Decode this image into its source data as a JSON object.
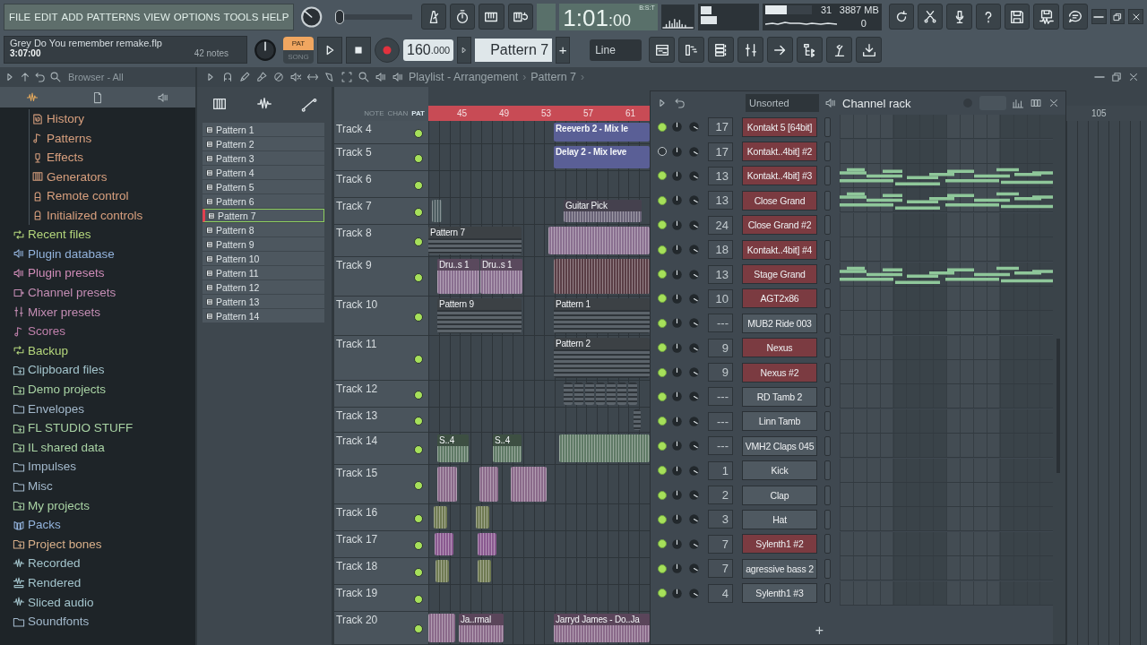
{
  "menu": [
    "FILE",
    "EDIT",
    "ADD",
    "PATTERNS",
    "VIEW",
    "OPTIONS",
    "TOOLS",
    "HELP"
  ],
  "song": {
    "title": "Grey Do You remember remake.flp",
    "length": "3:07:00",
    "notes": "42 notes"
  },
  "transport": {
    "pat": "PAT",
    "song": "SONG",
    "pat_selected": true,
    "tempo": "160",
    "tempo_fraction": ".000",
    "pattern": "Pattern 7",
    "add_pattern": "+"
  },
  "clock": {
    "main": "1:01",
    "sub": ":00",
    "format": "B:S:T"
  },
  "meters": {
    "cpu": "31",
    "level": 0.45,
    "memory": "3887 MB",
    "polyphony": "0"
  },
  "snap": "Line",
  "pitch": {
    "level": 0
  },
  "browser": {
    "title": "Browser - All",
    "project_items": [
      {
        "label": "History",
        "kind": "history",
        "color": "#d9a07e"
      },
      {
        "label": "Patterns",
        "kind": "note",
        "color": "#d9a07e"
      },
      {
        "label": "Effects",
        "kind": "effect",
        "color": "#d9a07e"
      },
      {
        "label": "Generators",
        "kind": "keys",
        "color": "#d9a07e"
      },
      {
        "label": "Remote control",
        "kind": "remote",
        "color": "#d9a07e"
      },
      {
        "label": "Initialized controls",
        "kind": "remote",
        "color": "#d9a07e"
      }
    ],
    "items": [
      {
        "label": "Recent files",
        "kind": "recycle",
        "color": "#b5d77c"
      },
      {
        "label": "Plugin database",
        "kind": "speaker",
        "color": "#93b3dc"
      },
      {
        "label": "Plugin presets",
        "kind": "speaker",
        "color": "#d08cb8"
      },
      {
        "label": "Channel presets",
        "kind": "channel",
        "color": "#c48db4"
      },
      {
        "label": "Mixer presets",
        "kind": "mixer",
        "color": "#c48db4"
      },
      {
        "label": "Scores",
        "kind": "note",
        "color": "#c080ac"
      },
      {
        "label": "Backup",
        "kind": "recycle",
        "color": "#b5d77c"
      },
      {
        "label": "Clipboard files",
        "kind": "folder-plus",
        "color": "#a3c4cc"
      },
      {
        "label": "Demo projects",
        "kind": "folder-plus",
        "color": "#a9d3a4"
      },
      {
        "label": "Envelopes",
        "kind": "folder",
        "color": "#a3b9cc"
      },
      {
        "label": "FL STUDIO STUFF",
        "kind": "folder-plus",
        "color": "#a9d3a4"
      },
      {
        "label": "IL shared data",
        "kind": "folder-plus",
        "color": "#a9d3a4"
      },
      {
        "label": "Impulses",
        "kind": "folder",
        "color": "#a3b9cc"
      },
      {
        "label": "Misc",
        "kind": "folder",
        "color": "#a3b9cc"
      },
      {
        "label": "My projects",
        "kind": "folder-plus",
        "color": "#a9d3a4"
      },
      {
        "label": "Packs",
        "kind": "packs",
        "color": "#93b3dc"
      },
      {
        "label": "Project bones",
        "kind": "folder-plus",
        "color": "#d9b08a"
      },
      {
        "label": "Recorded",
        "kind": "wave",
        "color": "#a3c4cc"
      },
      {
        "label": "Rendered",
        "kind": "rendered",
        "color": "#a3c4cc"
      },
      {
        "label": "Sliced audio",
        "kind": "wave",
        "color": "#a3c4cc"
      },
      {
        "label": "Soundfonts",
        "kind": "folder",
        "color": "#a3b9cc"
      }
    ]
  },
  "patterns": [
    {
      "label": "Pattern 1",
      "selected": false
    },
    {
      "label": "Pattern 2",
      "selected": false
    },
    {
      "label": "Pattern 3",
      "selected": false
    },
    {
      "label": "Pattern 4",
      "selected": false
    },
    {
      "label": "Pattern 5",
      "selected": false
    },
    {
      "label": "Pattern 6",
      "selected": false
    },
    {
      "label": "Pattern 7",
      "selected": true
    },
    {
      "label": "Pattern 8",
      "selected": false
    },
    {
      "label": "Pattern 9",
      "selected": false
    },
    {
      "label": "Pattern 10",
      "selected": false
    },
    {
      "label": "Pattern 11",
      "selected": false
    },
    {
      "label": "Pattern 12",
      "selected": false
    },
    {
      "label": "Pattern 13",
      "selected": false
    },
    {
      "label": "Pattern 14",
      "selected": false
    }
  ],
  "playlist": {
    "title": "Playlist - Arrangement",
    "separator": "›",
    "pattern": "Pattern 7",
    "modes": [
      {
        "label": "NOTE",
        "selected": false
      },
      {
        "label": "CHAN",
        "selected": false
      },
      {
        "label": "PAT",
        "selected": true
      }
    ],
    "ruler": [
      "45",
      "49",
      "53",
      "57",
      "61"
    ],
    "tracks": [
      {
        "name": "Track 4",
        "enabled": true,
        "clips": [
          {
            "kind": "automation",
            "label": "Reeverb 2 - Mix le",
            "color": "#5a5f96"
          }
        ]
      },
      {
        "name": "Track 5",
        "enabled": true,
        "clips": [
          {
            "kind": "automation",
            "label": "Delay 2 - Mix leve",
            "color": "#5a5f96"
          }
        ]
      },
      {
        "name": "Track 6",
        "enabled": true
      },
      {
        "name": "Track 7",
        "enabled": true,
        "clips": [
          {
            "kind": "audio",
            "color": "#4a5a5e"
          },
          {
            "kind": "audio",
            "label": "Guitar Pick",
            "color": "#6a6478"
          }
        ]
      },
      {
        "name": "Track 8",
        "enabled": true,
        "clips": [
          {
            "kind": "pattern",
            "label": "Pattern 7",
            "color": "#5c646b"
          },
          {
            "kind": "audio",
            "color": "#8a7090"
          }
        ]
      },
      {
        "name": "Track 9",
        "enabled": true,
        "clips": [
          {
            "kind": "audio",
            "label": "Dru..s 1",
            "color": "#8a7090"
          },
          {
            "kind": "audio",
            "label": "Dru..s 1",
            "color": "#8a7090"
          },
          {
            "kind": "audio",
            "color": "#5a3e46"
          }
        ]
      },
      {
        "name": "Track 10",
        "enabled": true,
        "clips": [
          {
            "kind": "pattern",
            "label": "Pattern 9",
            "color": "#5c646b"
          },
          {
            "kind": "pattern",
            "label": "Pattern 1",
            "color": "#5c646b"
          }
        ]
      },
      {
        "name": "Track 11",
        "enabled": true,
        "clips": [
          {
            "kind": "pattern",
            "label": "Pattern 2",
            "color": "#5c646b"
          }
        ]
      },
      {
        "name": "Track 12",
        "enabled": true,
        "clips": [
          {
            "kind": "pattern",
            "color": "#5c646b"
          },
          {
            "kind": "pattern",
            "color": "#5c646b"
          },
          {
            "kind": "pattern",
            "color": "#5c646b"
          },
          {
            "kind": "pattern",
            "color": "#5c646b"
          },
          {
            "kind": "pattern",
            "color": "#5c646b"
          },
          {
            "kind": "pattern",
            "color": "#5c646b"
          },
          {
            "kind": "pattern",
            "color": "#5c646b"
          }
        ]
      },
      {
        "name": "Track 13",
        "enabled": true,
        "clips": [
          {
            "kind": "pattern",
            "color": "#5c646b"
          }
        ]
      },
      {
        "name": "Track 14",
        "enabled": true,
        "clips": [
          {
            "kind": "audio",
            "label": "S..4",
            "color": "#5f7a66"
          },
          {
            "kind": "audio",
            "label": "S..4",
            "color": "#5f7a66"
          },
          {
            "kind": "audio",
            "color": "#5f7a66"
          }
        ]
      },
      {
        "name": "Track 15",
        "enabled": true,
        "clips": [
          {
            "kind": "audio",
            "color": "#8a6a8a"
          },
          {
            "kind": "audio",
            "color": "#8a6a8a"
          },
          {
            "kind": "audio",
            "color": "#8a6a8a"
          }
        ]
      },
      {
        "name": "Track 16",
        "enabled": true,
        "clips": [
          {
            "kind": "audio",
            "color": "#6f7a52"
          },
          {
            "kind": "audio",
            "color": "#6f7a52"
          }
        ]
      },
      {
        "name": "Track 17",
        "enabled": true,
        "clips": [
          {
            "kind": "audio",
            "color": "#8a5a90"
          },
          {
            "kind": "audio",
            "color": "#8a5a90"
          }
        ]
      },
      {
        "name": "Track 18",
        "enabled": true,
        "clips": [
          {
            "kind": "audio",
            "color": "#6f7a52"
          },
          {
            "kind": "audio",
            "color": "#6f7a52"
          }
        ]
      },
      {
        "name": "Track 19",
        "enabled": true
      },
      {
        "name": "Track 20",
        "enabled": true,
        "clips": [
          {
            "kind": "audio",
            "color": "#8a6a8a"
          },
          {
            "kind": "audio",
            "label": "Ja..rmal",
            "color": "#8a6a8a"
          },
          {
            "kind": "audio",
            "label": "Jarryd James - Do..Ja",
            "color": "#8a6a8a"
          }
        ]
      }
    ]
  },
  "channel_rack": {
    "filter": "Unsorted",
    "title": "Channel rack",
    "channels": [
      {
        "on": true,
        "track": "17",
        "name": "Kontakt 5 [64bit]",
        "color": "#7b3b41",
        "notes": false
      },
      {
        "on": false,
        "track": "17",
        "name": "Kontakt..4bit] #2",
        "color": "#7b3b41",
        "notes": false
      },
      {
        "on": true,
        "track": "13",
        "name": "Kontakt..4bit] #3",
        "color": "#7b3b41",
        "notes": true
      },
      {
        "on": true,
        "track": "13",
        "name": "Close Grand",
        "color": "#7b3b41",
        "notes": true
      },
      {
        "on": true,
        "track": "24",
        "name": "Close Grand #2",
        "color": "#7b3b41",
        "notes": false
      },
      {
        "on": true,
        "track": "18",
        "name": "Kontakt..4bit] #4",
        "color": "#7b3b41",
        "notes": false
      },
      {
        "on": true,
        "track": "13",
        "name": "Stage Grand",
        "color": "#7b3b41",
        "notes": true
      },
      {
        "on": true,
        "track": "10",
        "name": "AGT2x86",
        "color": "#7b3b41",
        "notes": false
      },
      {
        "on": true,
        "track": "---",
        "name": "MUB2 Ride 003",
        "color": "#4f5961",
        "notes": false
      },
      {
        "on": true,
        "track": "9",
        "name": "Nexus",
        "color": "#7b3b41",
        "notes": false
      },
      {
        "on": true,
        "track": "9",
        "name": "Nexus #2",
        "color": "#7b3b41",
        "notes": false
      },
      {
        "on": true,
        "track": "---",
        "name": "RD Tamb 2",
        "color": "#4f5961",
        "notes": false
      },
      {
        "on": true,
        "track": "---",
        "name": "Linn Tamb",
        "color": "#4f5961",
        "notes": false
      },
      {
        "on": true,
        "track": "---",
        "name": "VMH2 Claps 045",
        "color": "#4f5961",
        "notes": false
      },
      {
        "on": true,
        "track": "1",
        "name": "Kick",
        "color": "#4f5961",
        "notes": false
      },
      {
        "on": true,
        "track": "2",
        "name": "Clap",
        "color": "#4f5961",
        "notes": false
      },
      {
        "on": true,
        "track": "3",
        "name": "Hat",
        "color": "#4f5961",
        "notes": false
      },
      {
        "on": true,
        "track": "7",
        "name": "Sylenth1 #2",
        "color": "#7b3b41",
        "notes": false
      },
      {
        "on": true,
        "track": "7",
        "name": "agressive bass 2",
        "color": "#4f5961",
        "notes": false
      },
      {
        "on": true,
        "track": "4",
        "name": "Sylenth1 #3",
        "color": "#4f5961",
        "notes": false
      }
    ],
    "add": "+"
  },
  "right_ruler": "105"
}
